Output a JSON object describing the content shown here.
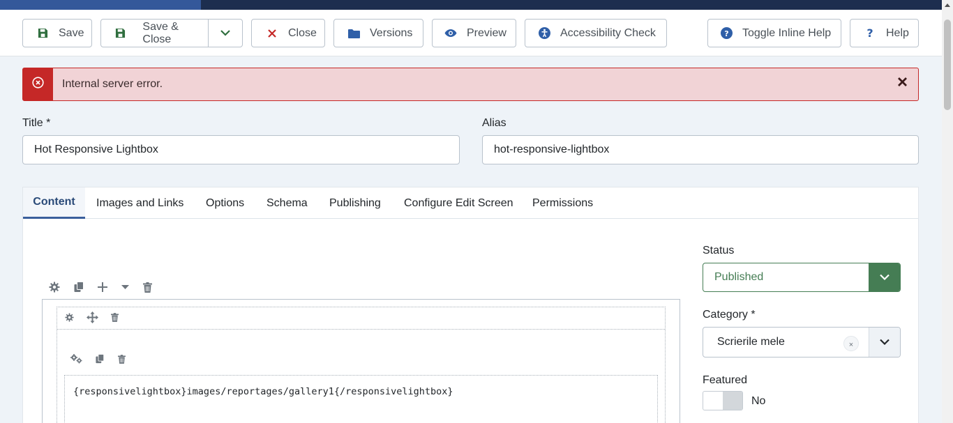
{
  "toolbar": {
    "save_label": "Save",
    "save_close_label": "Save & Close",
    "close_label": "Close",
    "versions_label": "Versions",
    "preview_label": "Preview",
    "accessibility_label": "Accessibility Check",
    "toggle_help_label": "Toggle Inline Help",
    "help_label": "Help"
  },
  "alert": {
    "message": "Internal server error."
  },
  "form": {
    "title_label": "Title *",
    "title_value": "Hot Responsive Lightbox",
    "alias_label": "Alias",
    "alias_value": "hot-responsive-lightbox"
  },
  "tabs": [
    {
      "label": "Content"
    },
    {
      "label": "Images and Links"
    },
    {
      "label": "Options"
    },
    {
      "label": "Schema"
    },
    {
      "label": "Publishing"
    },
    {
      "label": "Configure Edit Screen"
    },
    {
      "label": "Permissions"
    }
  ],
  "editor": {
    "code_text": "{responsivelightbox}images/reportages/gallery1{/responsivelightbox}"
  },
  "sidebar": {
    "status_label": "Status",
    "status_value": "Published",
    "category_label": "Category *",
    "category_value": "Scrierile mele",
    "category_clear": "×",
    "featured_label": "Featured",
    "featured_value": "No"
  },
  "colors": {
    "accent": "#3a5f9c",
    "danger": "#c52827",
    "success": "#457d54",
    "header_dark": "#1d2e4f"
  }
}
